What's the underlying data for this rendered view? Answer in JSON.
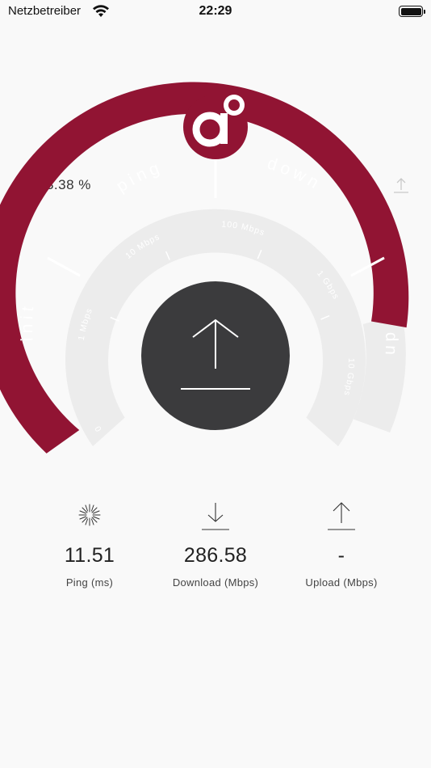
{
  "status_bar": {
    "carrier": "Netzbetreiber",
    "time": "22:29"
  },
  "progress": {
    "value": "83.38 %",
    "icon": "hourglass-icon"
  },
  "gauge": {
    "phases": {
      "init": "init",
      "ping": "ping",
      "down": "down",
      "up": "up"
    },
    "scale": [
      "0",
      "1 Mbps",
      "10 Mbps",
      "100 Mbps",
      "1 Gbps",
      "10 Gbps"
    ],
    "center_icon": "upload-arrow-icon",
    "accent_color": "#911433",
    "track_color": "#ececec",
    "center_color": "#3b3b3d"
  },
  "results": {
    "ping": {
      "value": "11.51",
      "label": "Ping (ms)",
      "icon": "ping-burst-icon"
    },
    "download": {
      "value": "286.58",
      "label": "Download (Mbps)",
      "icon": "download-arrow-icon"
    },
    "upload": {
      "value": "-",
      "label": "Upload (Mbps)",
      "icon": "upload-arrow-icon"
    }
  }
}
